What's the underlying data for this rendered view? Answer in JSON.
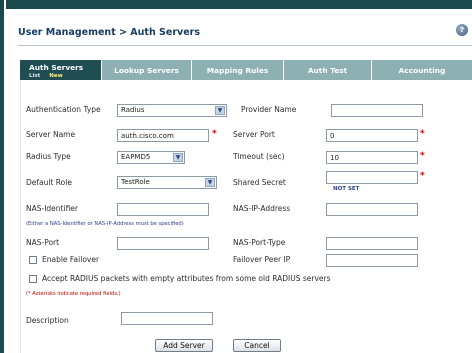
{
  "header": {
    "title": "User Management > Auth Servers",
    "help_icon": "help-icon"
  },
  "tabs": [
    {
      "label": "Auth Servers",
      "active": true,
      "subtabs": [
        {
          "label": "List",
          "active": false
        },
        {
          "label": "New",
          "active": true
        }
      ]
    },
    {
      "label": "Lookup Servers",
      "active": false
    },
    {
      "label": "Mapping Rules",
      "active": false
    },
    {
      "label": "Auth Test",
      "active": false
    },
    {
      "label": "Accounting",
      "active": false
    }
  ],
  "form": {
    "auth_type": {
      "label": "Authentication Type",
      "value": "Radius"
    },
    "provider_name": {
      "label": "Provider Name",
      "value": ""
    },
    "server_name": {
      "label": "Server Name",
      "value": "auth.cisco.com"
    },
    "server_port": {
      "label": "Server Port",
      "value": "0"
    },
    "radius_type": {
      "label": "Radius Type",
      "value": "EAPMD5"
    },
    "timeout": {
      "label": "Timeout (sec)",
      "value": "10"
    },
    "default_role": {
      "label": "Default Role",
      "value": "TestRole"
    },
    "shared_secret": {
      "label": "Shared Secret",
      "value": "",
      "status": "NOT SET"
    },
    "nas_identifier": {
      "label": "NAS-Identifier",
      "value": ""
    },
    "nas_ip_address": {
      "label": "NAS-IP-Address",
      "value": ""
    },
    "nas_note": "(Either a NAS-Identifier or NAS-IP-Address must be specified)",
    "nas_port": {
      "label": "NAS-Port",
      "value": ""
    },
    "nas_port_type": {
      "label": "NAS-Port-Type",
      "value": ""
    },
    "enable_failover": {
      "label": "Enable Failover",
      "checked": false
    },
    "failover_peer_ip": {
      "label": "Failover Peer IP",
      "value": ""
    },
    "accept_radius": {
      "label": "Accept RADIUS packets with empty attributes from some old RADIUS servers",
      "checked": false
    },
    "required_note": "(* Asterisks indicate required fields.)",
    "required_mark": "*",
    "description": {
      "label": "Description",
      "value": ""
    }
  },
  "buttons": {
    "add_server": "Add Server",
    "cancel": "Cancel"
  },
  "colors": {
    "header_bar": "#1a4a4e",
    "tab_active": "#1f4d52",
    "tab_inactive": "#8db0b3",
    "required": "#d60000",
    "note_text": "#2b3f8a"
  }
}
